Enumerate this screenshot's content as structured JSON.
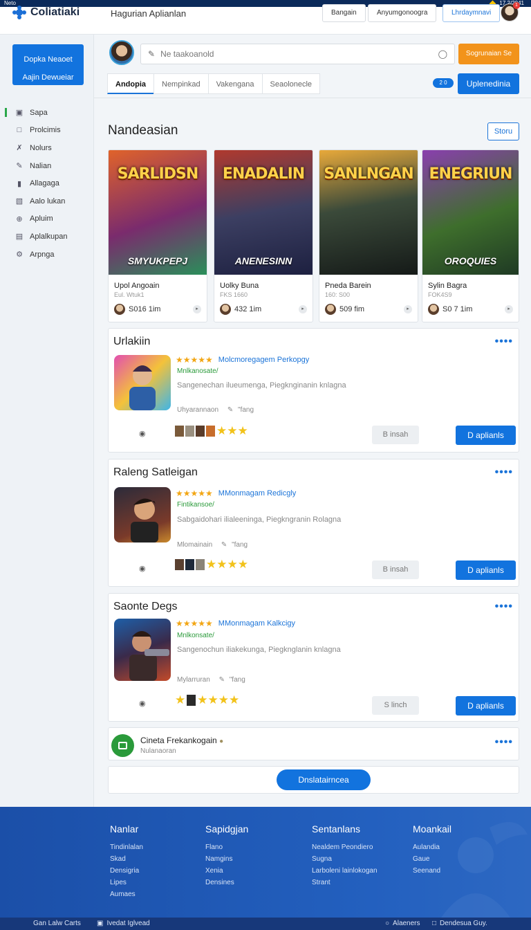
{
  "os_bar": {
    "left": "Neto",
    "right": "17 2/2041"
  },
  "header": {
    "app_name": "Coliatiaki",
    "title": "Hagurian Aplianlan",
    "buttons": [
      "Bangain",
      "Anyumgonoogra",
      "Lhrdaymnavi"
    ],
    "notification_count": "1"
  },
  "sidebar": {
    "promo_lines": [
      "Dopka Neaoet",
      "Aajin Dewueiar"
    ],
    "items": [
      {
        "label": "Sapa",
        "icon": "dashboard-icon"
      },
      {
        "label": "Prolcimis",
        "icon": "square-icon"
      },
      {
        "label": "Nolurs",
        "icon": "tools-icon"
      },
      {
        "label": "Nalian",
        "icon": "pen-icon"
      },
      {
        "label": "Allagaga",
        "icon": "bar-icon"
      },
      {
        "label": "Aalo lukan",
        "icon": "box-icon"
      },
      {
        "label": "Apluim",
        "icon": "compass-icon"
      },
      {
        "label": "Aplalkupan",
        "icon": "window-icon"
      },
      {
        "label": "Arpnga",
        "icon": "gear-icon"
      }
    ]
  },
  "search": {
    "placeholder": "Ne taakoanold",
    "button": "Sogrunaian Se"
  },
  "tabs": [
    "Andopia",
    "Nempinkad",
    "Vakengana",
    "Seaolonecle"
  ],
  "tab_pill": "2 0",
  "update_button": "Uplenedinia",
  "featured": {
    "title": "Nandeasian",
    "store_button": "Storu",
    "cards": [
      {
        "art_title": "SARLIDSN",
        "art_sub": "SMYUKPEPJ",
        "name": "Upol Angoain",
        "meta": "Eul. Wtuk1",
        "stat": "S016 1im",
        "colors": [
          "#e0632a",
          "#7a2b6d",
          "#2a8f5a"
        ]
      },
      {
        "art_title": "ENADALIN",
        "art_sub": "ANENESINN",
        "name": "Uolky Buna",
        "meta": "FKS 1660",
        "stat": "432 1im",
        "colors": [
          "#b0392e",
          "#3c3f62",
          "#1d2040"
        ]
      },
      {
        "art_title": "SANLNGAN",
        "art_sub": "",
        "name": "Pneda Barein",
        "meta": "160: S00",
        "stat": "509 fim",
        "colors": [
          "#e8a93a",
          "#3b4a3a",
          "#151a18"
        ]
      },
      {
        "art_title": "ENEGRIUN",
        "art_sub": "OROQUIES",
        "name": "Sylin Bagra",
        "meta": "FOK4S9",
        "stat": "S0 7 1im",
        "colors": [
          "#8a3fae",
          "#3e6e2c",
          "#1f3a24"
        ]
      }
    ]
  },
  "apps": [
    {
      "section": "Urlakiin",
      "developer": "Molcmoregagem Perkopgy",
      "tag": "Mnlkanosate/",
      "description": "Sangenechan ilueumenga, Piegknginanin knlagna",
      "minor": "Uhyarannaon",
      "minor2": "\"fang",
      "secondary_button": "B insah",
      "primary_button": "D aplianls",
      "icon": "character-icon"
    },
    {
      "section": "Raleng Satleigan",
      "developer": "MMonmagam Redicgly",
      "tag": "Fintikansoe/",
      "description": "Sabgaidohari ilialeeninga, Piegkngranin Rolagna",
      "minor": "Mlomainain",
      "minor2": "\"fang",
      "secondary_button": "B insah",
      "primary_button": "D aplianls",
      "icon": "portrait-icon"
    },
    {
      "section": "Saonte Degs",
      "developer": "MMonmagam Kalkcigy",
      "tag": "Mnlkonsate/",
      "description": "Sangenochun iliakekunga, Piegknglanin knlagna",
      "minor": "Mylarruran",
      "minor2": "\"fang",
      "secondary_button": "S linch",
      "primary_button": "D aplianls",
      "icon": "blaster-icon"
    }
  ],
  "mini_panel": {
    "title": "Cineta Frekankogain",
    "subtitle": "Nulanaoran"
  },
  "more_button": "Dnslatairncea",
  "footer": {
    "columns": [
      {
        "title": "Nanlar",
        "links": [
          "Tindinlalan",
          "Skad",
          "Densigria",
          "Lipes",
          "Aumaes"
        ]
      },
      {
        "title": "Sapidgjan",
        "links": [
          "Flano",
          "Namgins",
          "Xenia",
          "Densines"
        ]
      },
      {
        "title": "Sentanlans",
        "links": [
          "Nealdem Peondiero",
          "Sugna",
          "Larboleni lainlokogan",
          "Strant"
        ]
      },
      {
        "title": "Moankail",
        "links": [
          "Aulandia",
          "Gaue",
          "Seenand"
        ]
      }
    ]
  },
  "bottom_bar": {
    "left1": "Gan Lalw Carts",
    "left2": "Ivedat Iglvead",
    "right1": "Alaeners",
    "right2": "Dendesua Guy."
  }
}
